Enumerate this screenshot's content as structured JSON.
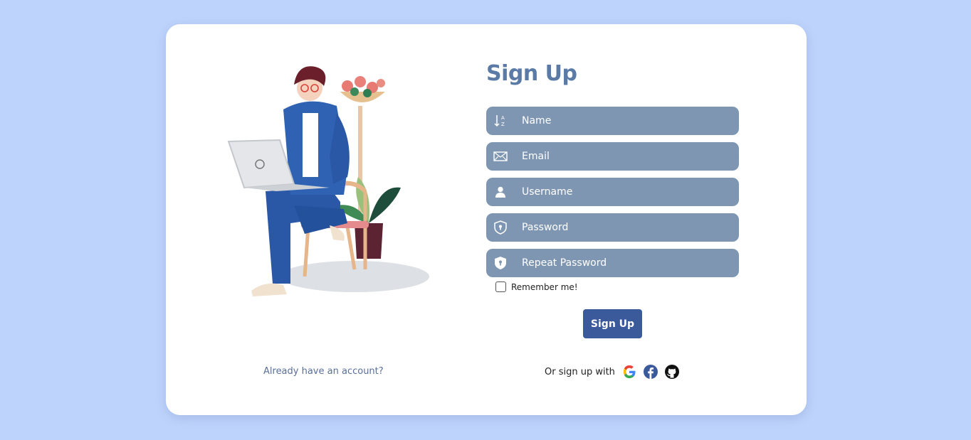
{
  "form": {
    "title": "Sign Up",
    "fields": [
      {
        "placeholder": "Name",
        "icon": "sort-alpha-icon"
      },
      {
        "placeholder": "Email",
        "icon": "envelope-icon"
      },
      {
        "placeholder": "Username",
        "icon": "user-icon"
      },
      {
        "placeholder": "Password",
        "icon": "shield-lock-icon"
      },
      {
        "placeholder": "Repeat Password",
        "icon": "shield-lock-filled-icon"
      }
    ],
    "remember_label": "Remember me!",
    "submit_label": "Sign Up"
  },
  "footer": {
    "login_link": "Already have an account?",
    "social_label": "Or sign up with",
    "social_icons": [
      "google-icon",
      "facebook-icon",
      "github-icon"
    ]
  },
  "colors": {
    "background": "#bdd3fb",
    "card": "#ffffff",
    "title": "#5b7ba6",
    "field": "#7f96b2",
    "button": "#3b5a9c",
    "link": "#5a6f98"
  }
}
